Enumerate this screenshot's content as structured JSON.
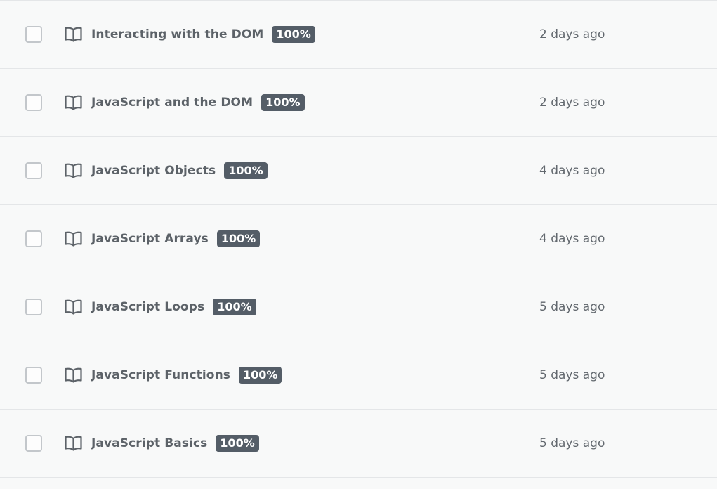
{
  "courses": [
    {
      "title": "Interacting with the DOM",
      "progress": "100%",
      "updated": "2 days ago",
      "icon": "book-icon"
    },
    {
      "title": "JavaScript and the DOM",
      "progress": "100%",
      "updated": "2 days ago",
      "icon": "book-icon"
    },
    {
      "title": "JavaScript Objects",
      "progress": "100%",
      "updated": "4 days ago",
      "icon": "book-icon"
    },
    {
      "title": "JavaScript Arrays",
      "progress": "100%",
      "updated": "4 days ago",
      "icon": "book-icon"
    },
    {
      "title": "JavaScript Loops",
      "progress": "100%",
      "updated": "5 days ago",
      "icon": "book-icon"
    },
    {
      "title": "JavaScript Functions",
      "progress": "100%",
      "updated": "5 days ago",
      "icon": "book-icon"
    },
    {
      "title": "JavaScript Basics",
      "progress": "100%",
      "updated": "5 days ago",
      "icon": "book-icon"
    }
  ],
  "colors": {
    "background": "#f8f9f9",
    "badge": "#545d67",
    "title": "#5c6268",
    "divider": "#e4e6e8"
  }
}
